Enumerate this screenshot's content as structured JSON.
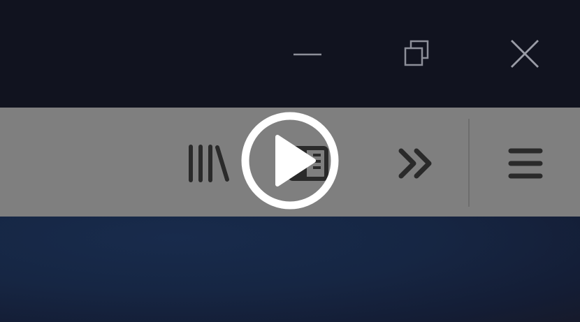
{
  "window_controls": {
    "minimize": {
      "icon": "minimize-icon",
      "color": "#8d8f99"
    },
    "restore": {
      "icon": "restore-icon",
      "color": "#8d8f99"
    },
    "close": {
      "icon": "close-icon",
      "color": "#9a9ca6"
    }
  },
  "toolbar": {
    "background": "#7f7f7f",
    "icon_color": "#2a2a2a",
    "buttons": [
      {
        "id": "library",
        "icon": "library-icon"
      },
      {
        "id": "sidebar",
        "icon": "sidebar-icon"
      },
      {
        "id": "overflow",
        "icon": "double-chevron-right-icon"
      },
      {
        "id": "menu",
        "icon": "hamburger-menu-icon"
      }
    ]
  },
  "overlay": {
    "icon": "play-icon",
    "color": "#ffffff"
  },
  "colors": {
    "titlebar": "#11131f",
    "content": "#162643"
  }
}
